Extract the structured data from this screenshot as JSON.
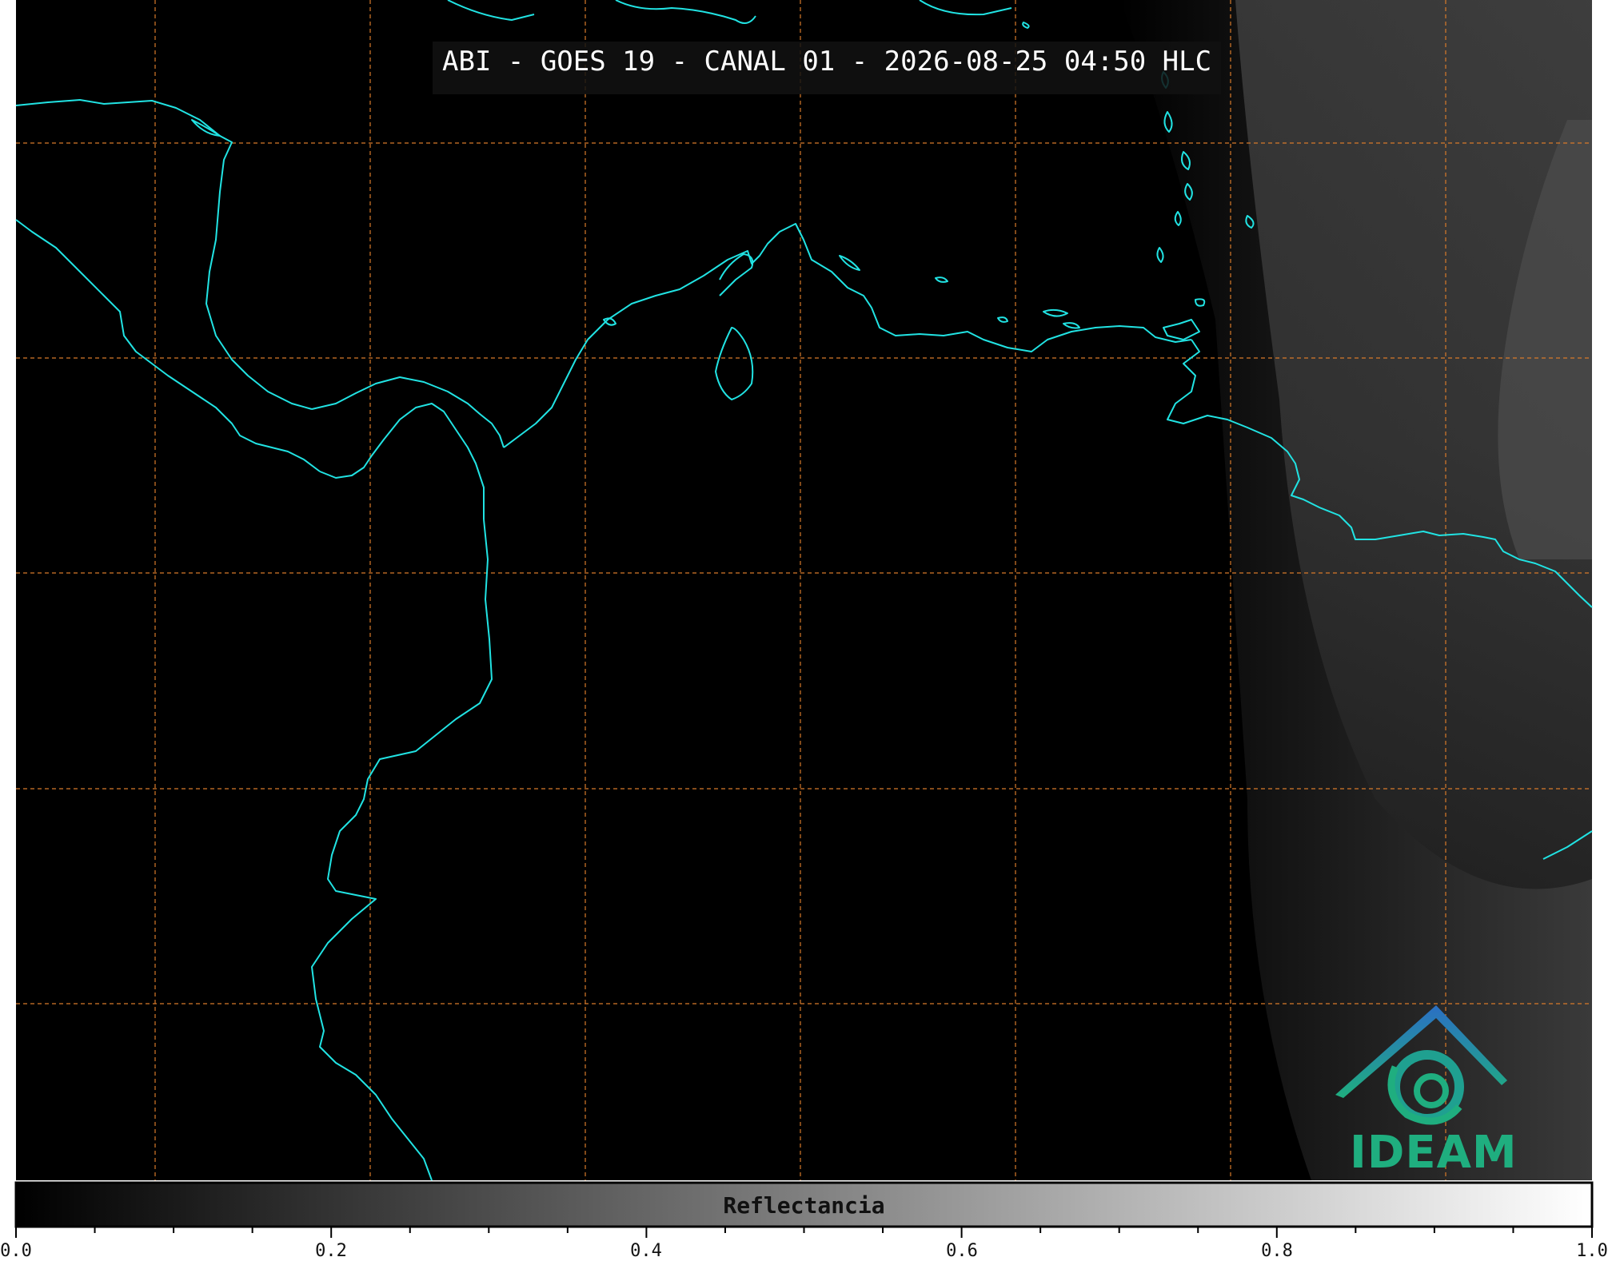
{
  "title": "ABI - GOES 19 - CANAL 01 - 2026-08-25 04:50 HLC",
  "logo": {
    "text": "IDEAM"
  },
  "colorbar": {
    "label": "Reflectancia",
    "min": 0.0,
    "max": 1.0,
    "tick_labels": [
      "0.0",
      "0.2",
      "0.4",
      "0.6",
      "0.8",
      "1.0"
    ],
    "gradient_start": "#000000",
    "gradient_end": "#ffffff"
  },
  "colors": {
    "coastline": "#21e3e3",
    "gridlines": "#d87a2a",
    "night_side": "#000000",
    "day_side_clouds": "#4a4a4a"
  }
}
